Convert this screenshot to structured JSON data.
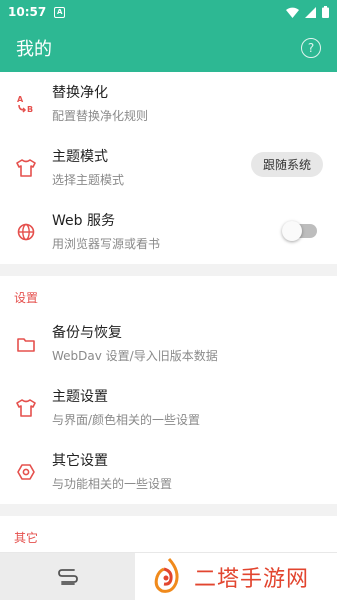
{
  "status_bar": {
    "time": "10:57",
    "notif_glyph": "A"
  },
  "app_bar": {
    "title": "我的",
    "help_glyph": "?"
  },
  "top_items": [
    {
      "name": "replace-purify",
      "icon": "ab-replace-icon",
      "title": "替换净化",
      "subtitle": "配置替换净化规则"
    },
    {
      "name": "theme-mode",
      "icon": "shirt-icon",
      "title": "主题模式",
      "subtitle": "选择主题模式",
      "value": "跟随系统"
    },
    {
      "name": "web-service",
      "icon": "globe-icon",
      "title": "Web 服务",
      "subtitle": "用浏览器写源或看书",
      "toggle": false
    }
  ],
  "settings_section": {
    "header": "设置",
    "items": [
      {
        "name": "backup-restore",
        "icon": "folder-icon",
        "title": "备份与恢复",
        "subtitle": "WebDav 设置/导入旧版本数据"
      },
      {
        "name": "theme-settings",
        "icon": "shirt-icon",
        "title": "主题设置",
        "subtitle": "与界面/颜色相关的一些设置"
      },
      {
        "name": "other-settings",
        "icon": "gear-icon",
        "title": "其它设置",
        "subtitle": "与功能相关的一些设置"
      }
    ]
  },
  "other_section": {
    "header": "其它"
  },
  "watermark": {
    "text": "二塔手游网"
  },
  "colors": {
    "primary": "#2db893",
    "accent": "#e5504d"
  }
}
